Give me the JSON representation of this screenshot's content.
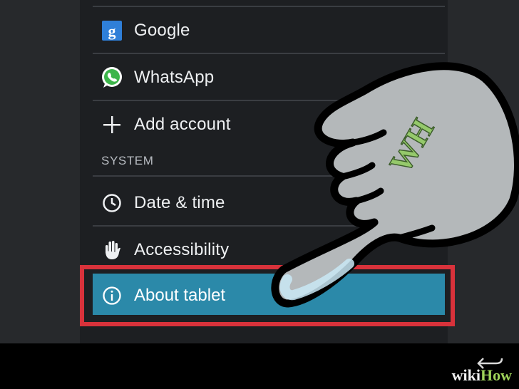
{
  "accounts": {
    "items": [
      {
        "label": "Google",
        "icon": "google-icon"
      },
      {
        "label": "WhatsApp",
        "icon": "whatsapp-icon"
      },
      {
        "label": "Add account",
        "icon": "plus-icon"
      }
    ]
  },
  "system": {
    "section_title": "SYSTEM",
    "items": [
      {
        "label": "Date & time",
        "icon": "clock-icon"
      },
      {
        "label": "Accessibility",
        "icon": "hand-icon"
      },
      {
        "label": "About tablet",
        "icon": "info-icon",
        "highlighted": true
      }
    ]
  },
  "highlight": {
    "color": "#d8323b",
    "selected_bg": "#2b89a9"
  },
  "watermark": {
    "prefix": "wiki",
    "suffix": "How"
  },
  "overlay": {
    "letters": "WH"
  }
}
